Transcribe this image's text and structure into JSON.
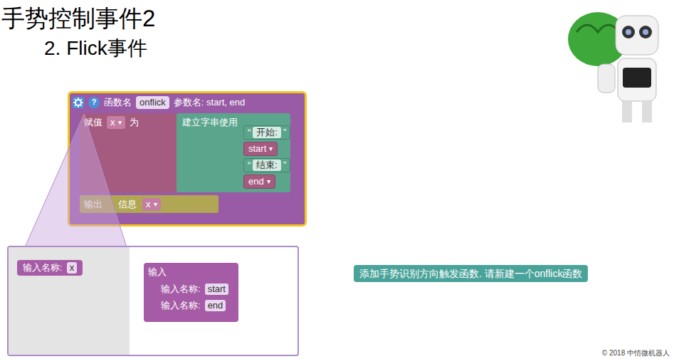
{
  "slide": {
    "title": "手势控制事件2",
    "subtitle": "2. Flick事件"
  },
  "function_block": {
    "selected": true,
    "help": "?",
    "label": "函数名",
    "name": "onflick",
    "params_label": "参数名: start, end",
    "assign": {
      "label": "赋值",
      "variable": "x",
      "dropdown": "▾",
      "to": "为"
    },
    "join": {
      "label": "建立字串使用",
      "items": [
        {
          "kind": "text",
          "value": "开始:",
          "quote_open": "“",
          "quote_close": "”"
        },
        {
          "kind": "variable",
          "value": "start",
          "dropdown": "▾"
        },
        {
          "kind": "text",
          "value": "结束:",
          "quote_open": "“",
          "quote_close": "”"
        },
        {
          "kind": "variable",
          "value": "end",
          "dropdown": "▾"
        }
      ]
    },
    "output": {
      "label_start": "输出",
      "label_end": "信息",
      "variable": "x",
      "dropdown": "▾"
    }
  },
  "mutator": {
    "left_block": {
      "label": "输入名称:",
      "value": "x"
    },
    "container": {
      "label": "输入",
      "items": [
        {
          "label": "输入名称:",
          "value": "start"
        },
        {
          "label": "输入名称:",
          "value": "end"
        }
      ]
    }
  },
  "hint": "添加手势识别方向触发函数. 请新建一个onflick函数",
  "copyright": "© 2018 中情微机器人"
}
